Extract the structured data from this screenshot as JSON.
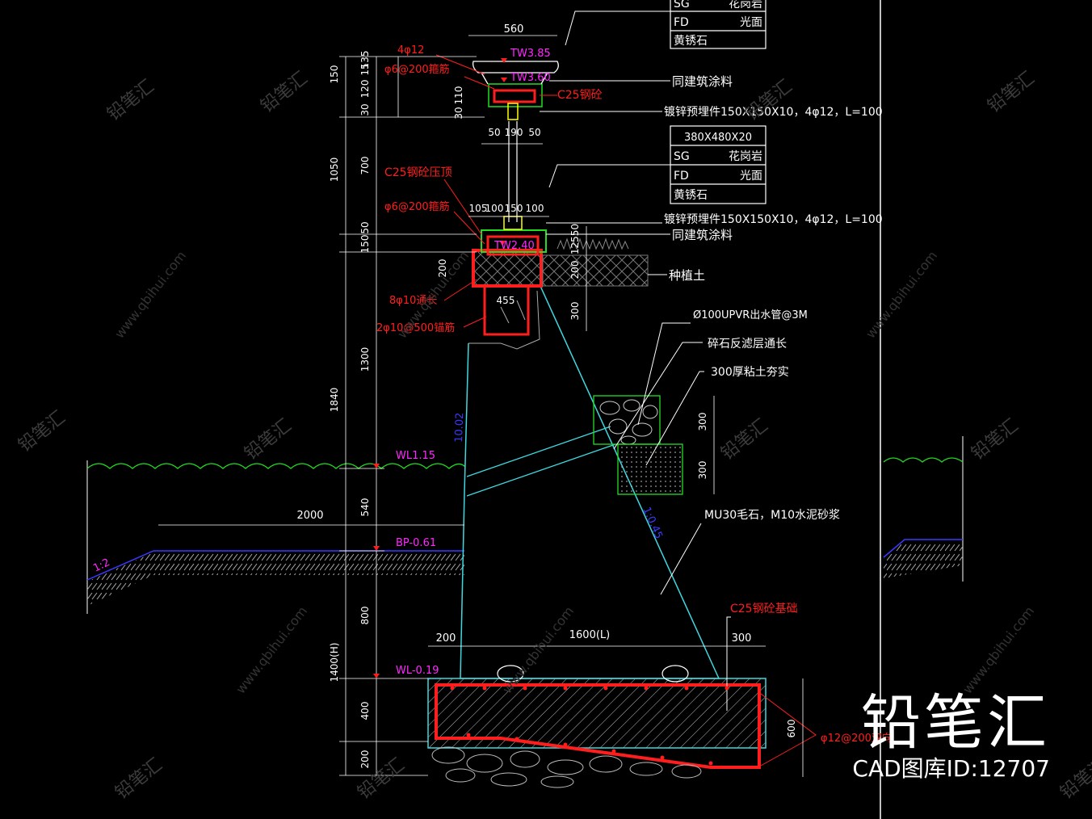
{
  "tables": {
    "top": {
      "header": "",
      "rows": [
        {
          "code": "SG",
          "val": "花岗岩"
        },
        {
          "code": "FD",
          "val": "光面"
        },
        {
          "code": "黄锈石",
          "val": ""
        }
      ]
    },
    "mid": {
      "header": "380X480X20",
      "rows": [
        {
          "code": "SG",
          "val": "花岗岩"
        },
        {
          "code": "FD",
          "val": "光面"
        },
        {
          "code": "黄锈石",
          "val": ""
        }
      ]
    }
  },
  "notes": {
    "coat_1": "同建筑涂料",
    "embed_1": "镀锌预埋件150X150X10，4φ12，L=100",
    "coat_2": "同建筑涂料",
    "embed_2": "镀锌预埋件150X150X10，4φ12，L=100",
    "soil": "种植土",
    "pipe": "Ø100UPVR出水管@3M",
    "gravel": "碎石反滤层通长",
    "clay": "300厚粘土夯实",
    "masonry": "MU30毛石，M10水泥砂浆"
  },
  "red_labels": {
    "r1": "4φ12",
    "r2": "φ6@200箍筋",
    "r3": "C25钢砼",
    "r4": "C25钢砼压顶",
    "r5": "φ6@200箍筋",
    "r6": "8φ10通长",
    "r7": "2φ10@500锚筋",
    "r8": "C25钢砼基础",
    "r9": "φ12@200双向"
  },
  "levels": {
    "tw1": "TW3.85",
    "tw2": "TW3.60",
    "tw3": "TW2.40",
    "wl1": "WL1.15",
    "bp": "BP-0.61",
    "wl2": "WL-0.19"
  },
  "slopes": {
    "s1": "10.02",
    "s2": "1:0.45",
    "s3": "1:2"
  },
  "dims": {
    "d560": "560",
    "d150a": "150",
    "d15": "15",
    "d135": "135",
    "d120": "120",
    "d30a": "30",
    "d110": "110",
    "d30b": "30",
    "d50a": "50",
    "d190": "190",
    "d50b": "50",
    "d1050": "1050",
    "d700": "700",
    "d150b": "150",
    "d50c": "50",
    "d105": "105",
    "d100a": "100",
    "d150c": "150",
    "d100b": "100",
    "d12550": "12550",
    "d200a": "200",
    "d455": "455",
    "d200b": "200",
    "d300a": "300",
    "d1300": "1300",
    "d1840": "1840",
    "d540": "540",
    "d2000": "2000",
    "d800": "800",
    "d1400": "1400(H)",
    "d400": "400",
    "d200c": "200",
    "d200d": "200",
    "d1600": "1600(L)",
    "d300b": "300",
    "d600": "600",
    "d300c": "300",
    "d300d": "300"
  },
  "watermark": {
    "brand": "铅笔汇",
    "id": "CAD图库ID:12707",
    "site": "www.qbihui.com"
  },
  "colors": {
    "white": "#ffffff",
    "red": "#ff1e1e",
    "cyan": "#3fd8e0",
    "magenta": "#ff28ff",
    "green": "#22dd22",
    "blue": "#3a3aff",
    "yellow": "#ffff00"
  }
}
